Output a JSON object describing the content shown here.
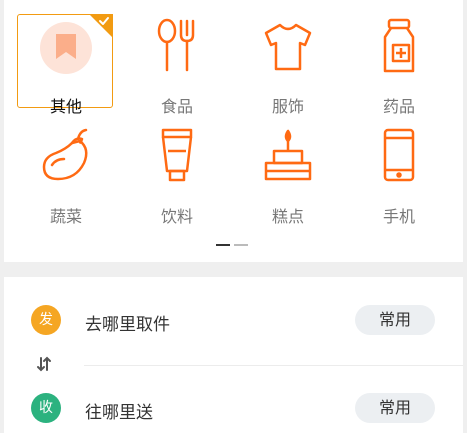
{
  "categories": [
    {
      "label": "其他",
      "icon": "tag-icon",
      "selected": true
    },
    {
      "label": "食品",
      "icon": "spoon-fork-icon"
    },
    {
      "label": "服饰",
      "icon": "tshirt-icon"
    },
    {
      "label": "药品",
      "icon": "medicine-bottle-icon"
    },
    {
      "label": "蔬菜",
      "icon": "eggplant-icon"
    },
    {
      "label": "饮料",
      "icon": "drink-cup-icon"
    },
    {
      "label": "糕点",
      "icon": "cake-icon"
    },
    {
      "label": "手机",
      "icon": "phone-icon"
    }
  ],
  "pagination": {
    "pages": 2,
    "current": 1
  },
  "pickup": {
    "badge": "发",
    "text": "去哪里取件",
    "action": "常用"
  },
  "delivery": {
    "badge": "收",
    "text": "往哪里送",
    "action": "常用"
  },
  "colors": {
    "accent": "#f29b12",
    "icon_orange": "#ff6a13",
    "pickup_badge": "#f5a623",
    "delivery_badge": "#2cb27f"
  }
}
